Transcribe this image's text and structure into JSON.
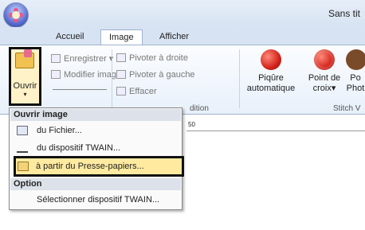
{
  "window": {
    "title": "Sans tit"
  },
  "tabs": [
    {
      "label": "Accueil"
    },
    {
      "label": "Image"
    },
    {
      "label": "Afficher"
    }
  ],
  "ribbon": {
    "ouvrir": {
      "label": "Ouvrir",
      "arrow": "▾"
    },
    "enregistrer": "Enregistrer ▾",
    "modifier": "Modifier image",
    "pivoter_droite": "Pivoter à droite",
    "pivoter_gauche": "Pivoter à gauche",
    "effacer": "Effacer",
    "group_edition": "dition",
    "piqure": "Piqûre",
    "automatique": "automatique",
    "point": "Point de",
    "croix": "croix",
    "po": "Po",
    "phot": "Phot",
    "group_stitch": "Stitch V"
  },
  "ruler": {
    "mark_50": "50"
  },
  "menu": {
    "header_open": "Ouvrir image",
    "items": [
      {
        "label": "du Fichier..."
      },
      {
        "label": "du dispositif TWAIN..."
      },
      {
        "label": "à partir du Presse-papiers..."
      }
    ],
    "header_option": "Option",
    "option_item": "Sélectionner dispositif TWAIN..."
  }
}
